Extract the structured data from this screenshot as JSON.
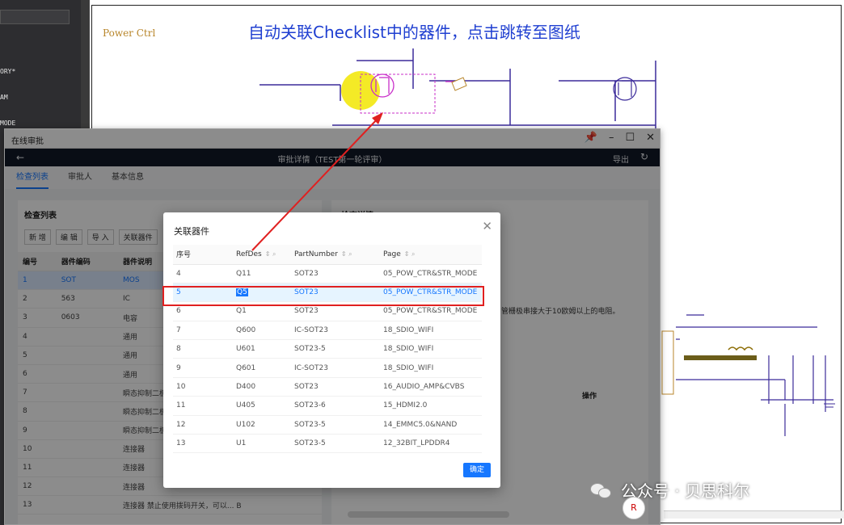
{
  "left_panel": {
    "labels": [
      "ORY*",
      "AM",
      "MODE"
    ]
  },
  "schematic": {
    "section_title": "Power Ctrl",
    "annotation": "自动关联Checklist中的器件，点击跳转至图纸"
  },
  "window": {
    "title": "在线审批",
    "header_title": "审批详情（TEST第一轮评审）",
    "back_icon": "arrow-left-icon",
    "export_label": "导出",
    "tabs": [
      {
        "label": "检查列表",
        "active": true
      },
      {
        "label": "审批人",
        "active": false
      },
      {
        "label": "基本信息",
        "active": false
      }
    ]
  },
  "checklist": {
    "title": "检查列表",
    "toolbar": [
      "新 增",
      "编 辑",
      "导 入",
      "关联器件"
    ],
    "columns": [
      "编号",
      "器件编码",
      "器件说明"
    ],
    "rows": [
      [
        "1",
        "SOT",
        "MOS"
      ],
      [
        "2",
        "563",
        "IC"
      ],
      [
        "3",
        "0603",
        "电容"
      ],
      [
        "4",
        "",
        "通用"
      ],
      [
        "5",
        "",
        "通用"
      ],
      [
        "6",
        "",
        "通用"
      ],
      [
        "7",
        "",
        "瞬态抑制二极"
      ],
      [
        "8",
        "",
        "瞬态抑制二极"
      ],
      [
        "9",
        "",
        "瞬态抑制二极"
      ],
      [
        "10",
        "",
        "连接器"
      ],
      [
        "11",
        "",
        "连接器"
      ],
      [
        "12",
        "",
        "连接器"
      ],
      [
        "13",
        "",
        "连接器"
      ]
    ],
    "row13_note": "禁止使用拨码开关，可以... B"
  },
  "detail": {
    "title": "检查详情",
    "text": "管栅极串接大于10欧姆以上的电阻。",
    "op_header": "操作"
  },
  "dialog": {
    "title": "关联器件",
    "columns": [
      "序号",
      "RefDes",
      "PartNumber",
      "Page"
    ],
    "rows": [
      [
        "4",
        "Q11",
        "SOT23",
        "05_POW_CTR&STR_MODE"
      ],
      [
        "5",
        "Q5",
        "SOT23",
        "05_POW_CTR&STR_MODE"
      ],
      [
        "6",
        "Q1",
        "SOT23",
        "05_POW_CTR&STR_MODE"
      ],
      [
        "7",
        "Q600",
        "IC-SOT23",
        "18_SDIO_WIFI"
      ],
      [
        "8",
        "U601",
        "SOT23-5",
        "18_SDIO_WIFI"
      ],
      [
        "9",
        "Q601",
        "IC-SOT23",
        "18_SDIO_WIFI"
      ],
      [
        "10",
        "D400",
        "SOT23",
        "16_AUDIO_AMP&CVBS"
      ],
      [
        "11",
        "U405",
        "SOT23-6",
        "15_HDMI2.0"
      ],
      [
        "12",
        "U102",
        "SOT23-5",
        "14_EMMC5.0&NAND"
      ],
      [
        "13",
        "U1",
        "SOT23-5",
        "12_32BIT_LPDDR4"
      ]
    ],
    "highlighted_row": 1,
    "ok_label": "确定"
  },
  "watermark": "公众号 · 贝思科尔"
}
